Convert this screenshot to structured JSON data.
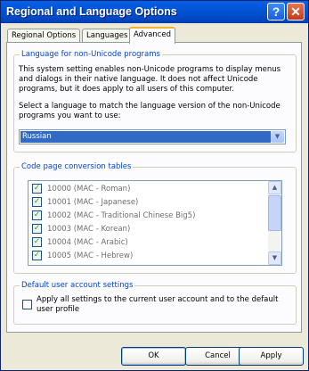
{
  "window": {
    "title": "Regional and Language Options",
    "help_glyph": "?",
    "close_glyph": "✕"
  },
  "tabs": [
    {
      "label": "Regional Options"
    },
    {
      "label": "Languages"
    },
    {
      "label": "Advanced",
      "active": true
    }
  ],
  "non_unicode": {
    "group_label": "Language for non-Unicode programs",
    "description": "This system setting enables non-Unicode programs to display menus and dialogs in their native language. It does not affect Unicode programs, but it does apply to all users of this computer.",
    "select_prompt": "Select a language to match the language version of the non-Unicode programs you want to use:",
    "selected_language": "Russian"
  },
  "codepages": {
    "group_label": "Code page conversion tables",
    "items": [
      {
        "label": "10000 (MAC - Roman)",
        "checked": true
      },
      {
        "label": "10001 (MAC - Japanese)",
        "checked": true
      },
      {
        "label": "10002 (MAC - Traditional Chinese Big5)",
        "checked": true
      },
      {
        "label": "10003 (MAC - Korean)",
        "checked": true
      },
      {
        "label": "10004 (MAC - Arabic)",
        "checked": true
      },
      {
        "label": "10005 (MAC - Hebrew)",
        "checked": true
      }
    ]
  },
  "default_user": {
    "group_label": "Default user account settings",
    "checkbox_label": "Apply all settings to the current user account and to the default user profile",
    "checked": false
  },
  "buttons": {
    "ok": "OK",
    "cancel": "Cancel",
    "apply": "Apply"
  },
  "colors": {
    "titlebar": "#0054e3",
    "dialog_bg": "#ece9d8",
    "group_label": "#0046d5",
    "selection": "#316ac5",
    "check": "#21a121"
  }
}
